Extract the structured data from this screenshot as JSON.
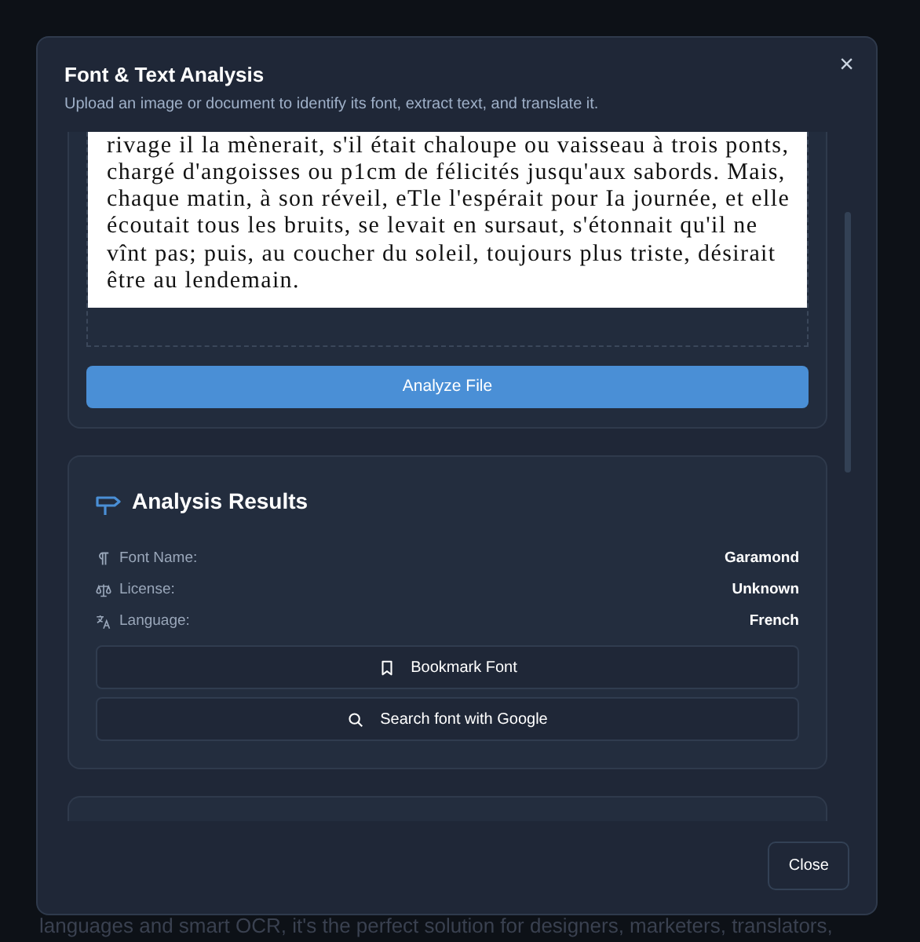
{
  "background": {
    "text": "languages and smart OCR, it's the perfect solution for designers, marketers, translators,"
  },
  "modal": {
    "title": "Font & Text Analysis",
    "subtitle": "Upload an image or document to identify its font, extract text, and translate it.",
    "close_label": "×"
  },
  "upload": {
    "document_lines": [
      "rivage il la mènerait, s'il était chaloupe ou vaisseau à trois ponts,",
      "chargé d'angoisses ou p1cm  de félicités jusqu'aux sabords. Mais,",
      "chaque matin, à son réveil, eTle l'espérait pour Ia journée, et elle",
      "écoutait tous les bruits, se levait en sursaut, s'étonnait qu'il ne",
      "vînt pas; puis, au coucher du soleil, toujours plus triste, désirait",
      "être au lendemain."
    ],
    "button": "Analyze File"
  },
  "results": {
    "title": "Analysis Results",
    "fields": [
      {
        "kind": "font",
        "label": "Font Name:",
        "value": "Garamond"
      },
      {
        "kind": "license",
        "label": "License:",
        "value": "Unknown"
      },
      {
        "kind": "language",
        "label": "Language:",
        "value": "French"
      }
    ],
    "actions": [
      {
        "kind": "bookmark",
        "label": "Bookmark Font"
      },
      {
        "kind": "search",
        "label": "Search font with Google"
      }
    ]
  },
  "footer": {
    "button": "Close"
  }
}
